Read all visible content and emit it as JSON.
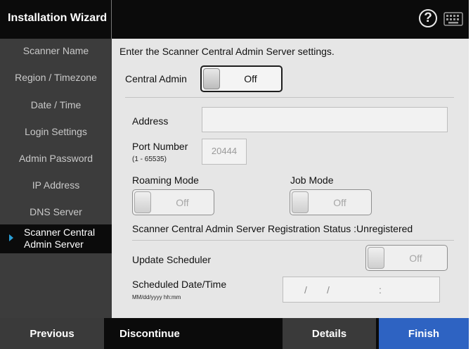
{
  "app": {
    "title": "Installation Wizard",
    "help_icon": "?"
  },
  "sidebar": {
    "items": [
      {
        "label": "Scanner Name"
      },
      {
        "label": "Region / Timezone"
      },
      {
        "label": "Date / Time"
      },
      {
        "label": "Login Settings"
      },
      {
        "label": "Admin Password"
      },
      {
        "label": "IP Address"
      },
      {
        "label": "DNS Server"
      },
      {
        "label_line1": "Scanner Central",
        "label_line2": "Admin Server",
        "active": true
      }
    ]
  },
  "main": {
    "instruction": "Enter the Scanner Central Admin Server settings.",
    "central_admin": {
      "label": "Central Admin",
      "state": "Off"
    },
    "address": {
      "label": "Address",
      "value": ""
    },
    "port": {
      "label": "Port Number",
      "range": "(1 - 65535)",
      "value": "20444"
    },
    "roaming_mode": {
      "label": "Roaming Mode",
      "state": "Off"
    },
    "job_mode": {
      "label": "Job Mode",
      "state": "Off"
    },
    "registration": {
      "label": "Scanner Central Admin Server Registration Status",
      "separator": ":",
      "value": "Unregistered"
    },
    "update_scheduler": {
      "label": "Update Scheduler",
      "state": "Off"
    },
    "scheduled": {
      "label": "Scheduled Date/Time",
      "format": "MM/dd/yyyy hh:mm",
      "slash1": "/",
      "slash2": "/",
      "colon": ":"
    }
  },
  "footer": {
    "previous": "Previous",
    "discontinue": "Discontinue",
    "details": "Details",
    "finish": "Finish"
  },
  "colors": {
    "titlebar": "#0b0b0b",
    "sidebar": "#3c3c3c",
    "panel": "#e6e6e6",
    "finish": "#2e63c2",
    "details": "#3a3a3a",
    "previous": "#3a3a3a",
    "active_arrow": "#2a9fd6"
  }
}
